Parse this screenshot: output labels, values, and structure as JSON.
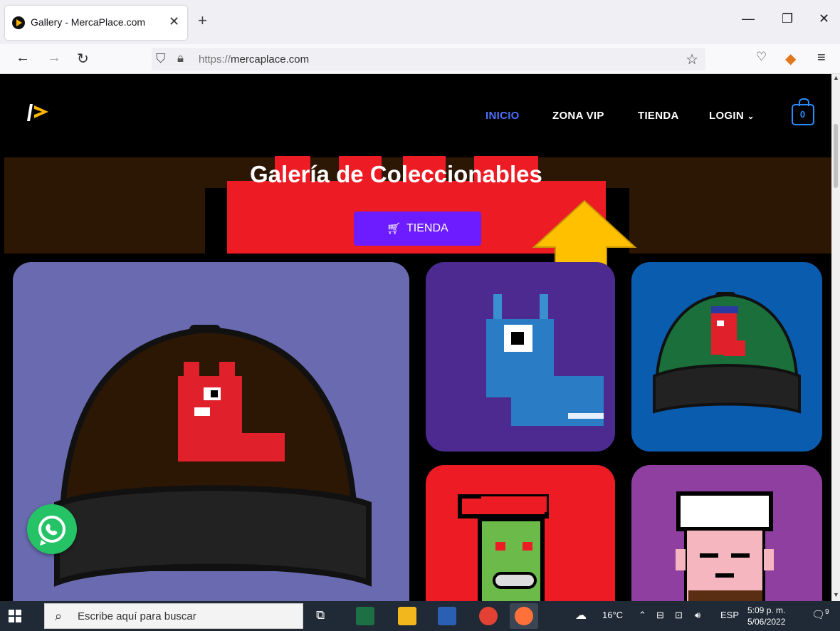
{
  "browser": {
    "tab_title": "Gallery - MercaPlace.com",
    "url_protocol": "https://",
    "url_host": "mercaplace.com"
  },
  "site": {
    "menu": [
      {
        "label": "INICIO",
        "active": true
      },
      {
        "label": "ZONA VIP",
        "active": false
      },
      {
        "label": "TIENDA",
        "active": false
      },
      {
        "label": "LOGIN",
        "active": false
      }
    ],
    "cart_count": "0",
    "hero_title": "Galería de Coleccionables",
    "hero_button": "TIENDA"
  },
  "colors": {
    "accent_blue": "#4a72ff",
    "hero_red": "#ec1b24",
    "button_purple": "#6d1cff",
    "arrow_yellow": "#ffc000",
    "whatsapp_green": "#25c365"
  },
  "taskbar": {
    "search_placeholder": "Escribe aquí para buscar",
    "weather": "16°C",
    "language": "ESP",
    "time": "5:09 p. m.",
    "date": "5/06/2022",
    "notification_count": "9"
  }
}
